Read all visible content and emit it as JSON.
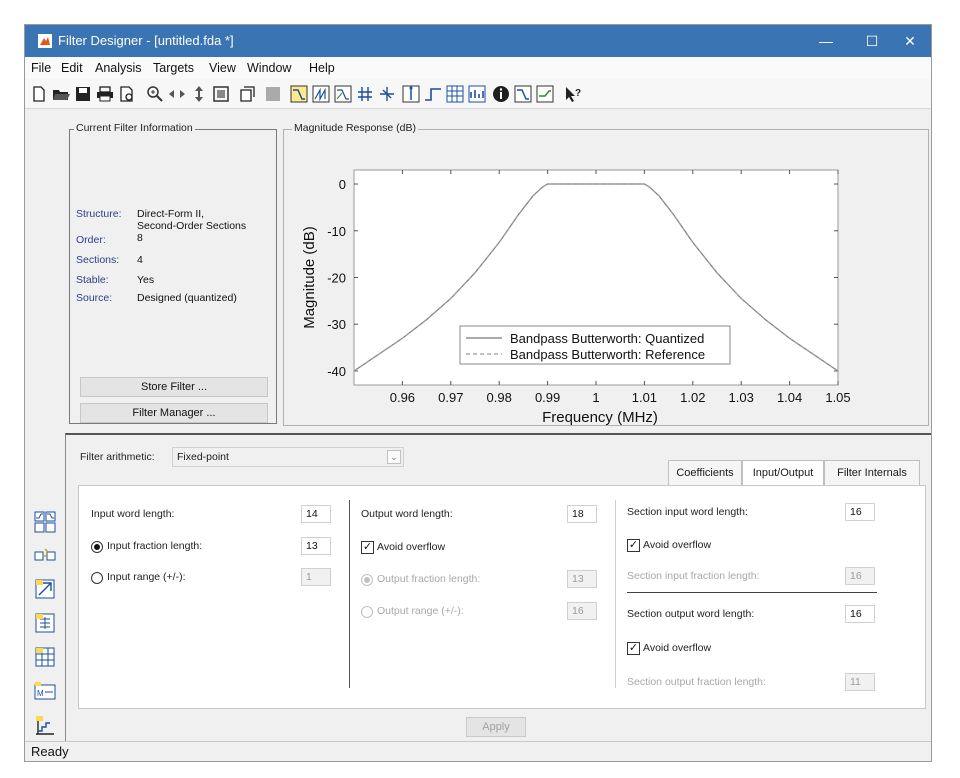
{
  "window": {
    "title": "Filter Designer - [untitled.fda *]",
    "controls": {
      "minimize": "—",
      "maximize": "☐",
      "close": "✕"
    }
  },
  "menu": [
    "File",
    "Edit",
    "Analysis",
    "Targets",
    "View",
    "Window",
    "Help"
  ],
  "toolbar_icons": [
    "new-icon",
    "open-icon",
    "save-icon",
    "print-icon",
    "print-preview-icon",
    "zoom-in-icon",
    "zoom-out-icon",
    "zoom-x-icon",
    "full-view-icon",
    "full-view-display-icon",
    "design-filter-icon",
    "magnitude-response-icon",
    "phase-response-icon",
    "mag-phase-icon",
    "group-delay-icon",
    "phase-delay-icon",
    "impulse-response-icon",
    "step-response-icon",
    "pole-zero-icon",
    "coefficients-icon",
    "info-icon",
    "filter-coefficients-icon",
    "cost-icon",
    "help-icon"
  ],
  "info_panel": {
    "title": "Current Filter Information",
    "rows": [
      {
        "key": "Structure:",
        "value": "Direct-Form II,"
      },
      {
        "key": "",
        "value": "Second-Order Sections"
      },
      {
        "key": "Order:",
        "value": "8"
      },
      {
        "key": "Sections:",
        "value": "4"
      },
      {
        "key": "Stable:",
        "value": "Yes"
      },
      {
        "key": "Source:",
        "value": "Designed (quantized)"
      }
    ],
    "store_button": "Store Filter ...",
    "manager_button": "Filter Manager ..."
  },
  "response_panel": {
    "title": "Magnitude Response (dB)"
  },
  "chart_data": {
    "type": "line",
    "title": "",
    "xlabel": "Frequency (MHz)",
    "ylabel": "Magnitude (dB)",
    "xlim": [
      0.95,
      1.05
    ],
    "ylim": [
      -43,
      3
    ],
    "xticks": [
      "0.96",
      "0.97",
      "0.98",
      "0.99",
      "1",
      "1.01",
      "1.02",
      "1.03",
      "1.04",
      "1.05"
    ],
    "xtick_values": [
      0.96,
      0.97,
      0.98,
      0.99,
      1.0,
      1.01,
      1.02,
      1.03,
      1.04,
      1.05
    ],
    "yticks": [
      "0",
      "-10",
      "-20",
      "-30",
      "-40"
    ],
    "ytick_values": [
      0,
      -10,
      -20,
      -30,
      -40
    ],
    "legend_position": "bottom-right",
    "series": [
      {
        "name": "Bandpass Butterworth: Quantized",
        "color": "#7a7a7a",
        "dash": "solid",
        "x": [
          0.95,
          0.955,
          0.96,
          0.965,
          0.97,
          0.975,
          0.98,
          0.984,
          0.987,
          0.989,
          0.99,
          0.995,
          1.0,
          1.005,
          1.01,
          1.011,
          1.013,
          1.016,
          1.02,
          1.025,
          1.03,
          1.035,
          1.04,
          1.045,
          1.05
        ],
        "y": [
          -40,
          -36.5,
          -33,
          -29,
          -24.5,
          -19,
          -12.5,
          -6.5,
          -2.5,
          -0.6,
          0,
          0,
          0,
          0,
          0,
          -0.6,
          -2.5,
          -6.5,
          -12.5,
          -19,
          -24.5,
          -29,
          -33,
          -36.5,
          -40
        ]
      },
      {
        "name": "Bandpass Butterworth: Reference",
        "color": "#9a9a9a",
        "dash": "dashed",
        "x": [
          0.95,
          0.955,
          0.96,
          0.965,
          0.97,
          0.975,
          0.98,
          0.984,
          0.987,
          0.989,
          0.99,
          0.995,
          1.0,
          1.005,
          1.01,
          1.011,
          1.013,
          1.016,
          1.02,
          1.025,
          1.03,
          1.035,
          1.04,
          1.045,
          1.05
        ],
        "y": [
          -40,
          -36.5,
          -33,
          -29,
          -24.5,
          -19,
          -12.5,
          -6.5,
          -2.5,
          -0.6,
          0,
          0,
          0,
          0,
          0,
          -0.6,
          -2.5,
          -6.5,
          -12.5,
          -19,
          -24.5,
          -29,
          -33,
          -36.5,
          -40
        ]
      }
    ]
  },
  "arith": {
    "label": "Filter arithmetic:",
    "value": "Fixed-point",
    "tabs": [
      "Coefficients",
      "Input/Output",
      "Filter Internals"
    ],
    "active_tab": 1
  },
  "io": {
    "input_word_length_label": "Input word length:",
    "input_word_length": "14",
    "input_fraction_length_label": "Input fraction length:",
    "input_fraction_length": "13",
    "input_range_label": "Input range (+/-):",
    "input_range": "1",
    "output_word_length_label": "Output word length:",
    "output_word_length": "18",
    "avoid_overflow_label": "Avoid overflow",
    "output_fraction_length_label": "Output fraction length:",
    "output_fraction_length": "13",
    "output_range_label": "Output range (+/-):",
    "output_range": "16",
    "section_input_word_length_label": "Section input word length:",
    "section_input_word_length": "16",
    "section_input_fraction_length_label": "Section input fraction length:",
    "section_input_fraction_length": "16",
    "section_output_word_length_label": "Section output word length:",
    "section_output_word_length": "16",
    "section_output_fraction_length_label": "Section output fraction length:",
    "section_output_fraction_length": "11"
  },
  "apply_button": "Apply",
  "sidebar_icons": [
    "bandpass-design-icon",
    "transform-icon",
    "import-icon",
    "realize-model-icon",
    "pole-zero-editor-icon",
    "multirate-icon",
    "quantization-icon"
  ],
  "status": "Ready"
}
